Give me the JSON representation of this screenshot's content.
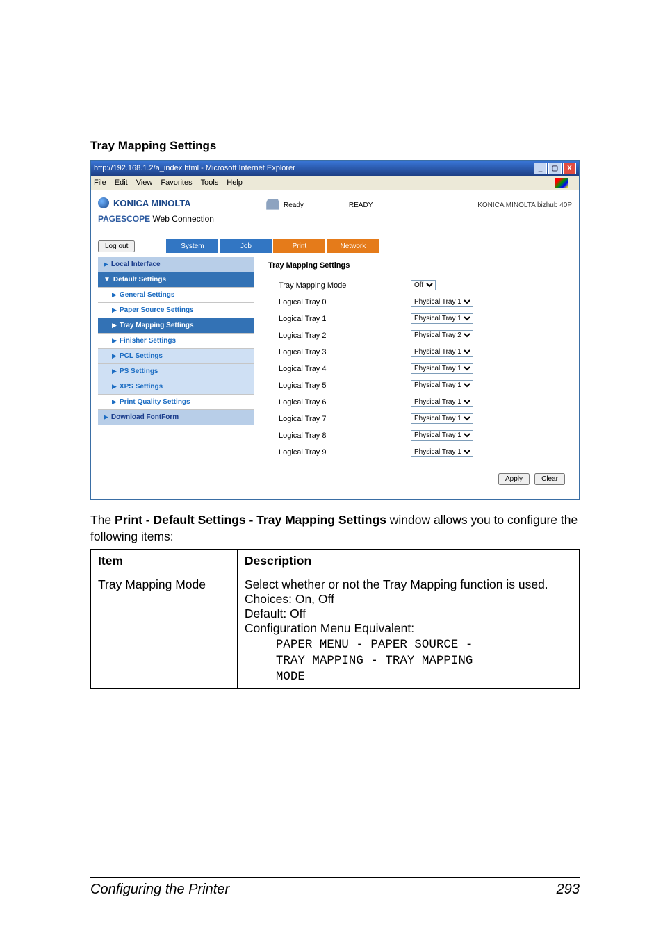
{
  "section_title": "Tray Mapping Settings",
  "ie": {
    "title_prefix": "http://192.168.1.2/a_index.html - Microsoft Internet Explorer",
    "menu": [
      "File",
      "Edit",
      "View",
      "Favorites",
      "Tools",
      "Help"
    ]
  },
  "brand": {
    "name": "KONICA MINOLTA",
    "psw_a": "PAGE",
    "psw_b": "SCOPE",
    "psw_c": "Web Connection"
  },
  "status": {
    "ready_icon": "Ready",
    "ready_big": "READY",
    "model": "KONICA MINOLTA bizhub 40P"
  },
  "logout": "Log out",
  "tabs": {
    "system": "System",
    "job": "Job",
    "print": "Print",
    "network": "Network"
  },
  "side": {
    "local": "Local Interface",
    "default": "Default Settings",
    "general": "General Settings",
    "paper": "Paper Source Settings",
    "traymap": "Tray Mapping Settings",
    "finisher": "Finisher Settings",
    "pcl": "PCL Settings",
    "ps": "PS Settings",
    "xps": "XPS Settings",
    "pq": "Print Quality Settings",
    "dlff": "Download FontForm"
  },
  "content": {
    "title": "Tray Mapping Settings",
    "mode_label": "Tray Mapping Mode",
    "mode_value": "Off",
    "rows": [
      {
        "l": "Logical Tray 0",
        "v": "Physical Tray 1"
      },
      {
        "l": "Logical Tray 1",
        "v": "Physical Tray 1"
      },
      {
        "l": "Logical Tray 2",
        "v": "Physical Tray 2"
      },
      {
        "l": "Logical Tray 3",
        "v": "Physical Tray 1"
      },
      {
        "l": "Logical Tray 4",
        "v": "Physical Tray 1"
      },
      {
        "l": "Logical Tray 5",
        "v": "Physical Tray 1"
      },
      {
        "l": "Logical Tray 6",
        "v": "Physical Tray 1"
      },
      {
        "l": "Logical Tray 7",
        "v": "Physical Tray 1"
      },
      {
        "l": "Logical Tray 8",
        "v": "Physical Tray 1"
      },
      {
        "l": "Logical Tray 9",
        "v": "Physical Tray 1"
      }
    ],
    "apply": "Apply",
    "clear": "Clear"
  },
  "body_para_a": "The ",
  "body_para_b": "Print - Default Settings - Tray Mapping Settings",
  "body_para_c": " window allows you to configure the following items:",
  "table": {
    "h1": "Item",
    "h2": "Description",
    "r1c1": "Tray Mapping Mode",
    "d1": "Select whether or not the Tray Mapping function is used.",
    "d2": "Choices: On, Off",
    "d3": "Default:  Off",
    "d4": "Configuration Menu Equivalent:",
    "c1": "PAPER MENU - PAPER SOURCE -",
    "c2": "TRAY MAPPING - TRAY MAPPING",
    "c3": "MODE"
  },
  "footer": {
    "left": "Configuring the Printer",
    "right": "293"
  }
}
